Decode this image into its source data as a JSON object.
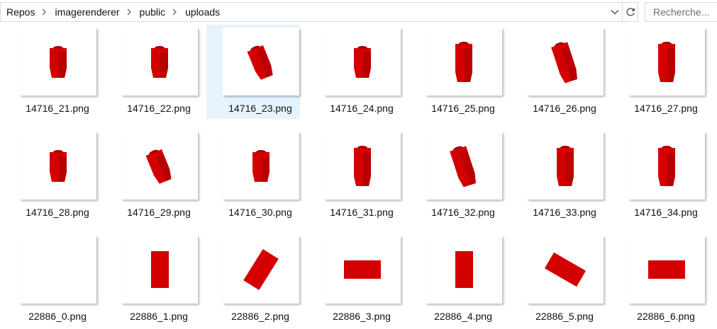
{
  "breadcrumb": [
    "Repos",
    "imagerenderer",
    "public",
    "uploads"
  ],
  "search": {
    "placeholder": "Recherche..."
  },
  "files": [
    {
      "name": "14716_21.png",
      "shape": "brick-front",
      "selected": false
    },
    {
      "name": "14716_22.png",
      "shape": "brick-front",
      "selected": false
    },
    {
      "name": "14716_23.png",
      "shape": "brick-tilt",
      "selected": true
    },
    {
      "name": "14716_24.png",
      "shape": "brick-front",
      "selected": false
    },
    {
      "name": "14716_25.png",
      "shape": "brick-tall",
      "selected": false
    },
    {
      "name": "14716_26.png",
      "shape": "brick-tall-tilt",
      "selected": false
    },
    {
      "name": "14716_27.png",
      "shape": "brick-tall",
      "selected": false
    },
    {
      "name": "14716_28.png",
      "shape": "brick-front",
      "selected": false
    },
    {
      "name": "14716_29.png",
      "shape": "brick-tilt",
      "selected": false
    },
    {
      "name": "14716_30.png",
      "shape": "brick-front",
      "selected": false
    },
    {
      "name": "14716_31.png",
      "shape": "brick-tall",
      "selected": false
    },
    {
      "name": "14716_32.png",
      "shape": "brick-tall-tilt",
      "selected": false
    },
    {
      "name": "14716_33.png",
      "shape": "brick-tall",
      "selected": false
    },
    {
      "name": "14716_34.png",
      "shape": "brick-tall",
      "selected": false
    },
    {
      "name": "22886_0.png",
      "shape": "empty",
      "selected": false
    },
    {
      "name": "22886_1.png",
      "shape": "plate-vertical",
      "selected": false
    },
    {
      "name": "22886_2.png",
      "shape": "plate-rot-ccw",
      "selected": false
    },
    {
      "name": "22886_3.png",
      "shape": "plate-horizontal",
      "selected": false
    },
    {
      "name": "22886_4.png",
      "shape": "plate-vertical",
      "selected": false
    },
    {
      "name": "22886_5.png",
      "shape": "plate-rot-cw",
      "selected": false
    },
    {
      "name": "22886_6.png",
      "shape": "plate-horizontal",
      "selected": false
    }
  ],
  "colors": {
    "brick": "#d40000",
    "brick_dark": "#9e0000",
    "brick_mid": "#b80000",
    "selection": "#e5f3ff"
  }
}
